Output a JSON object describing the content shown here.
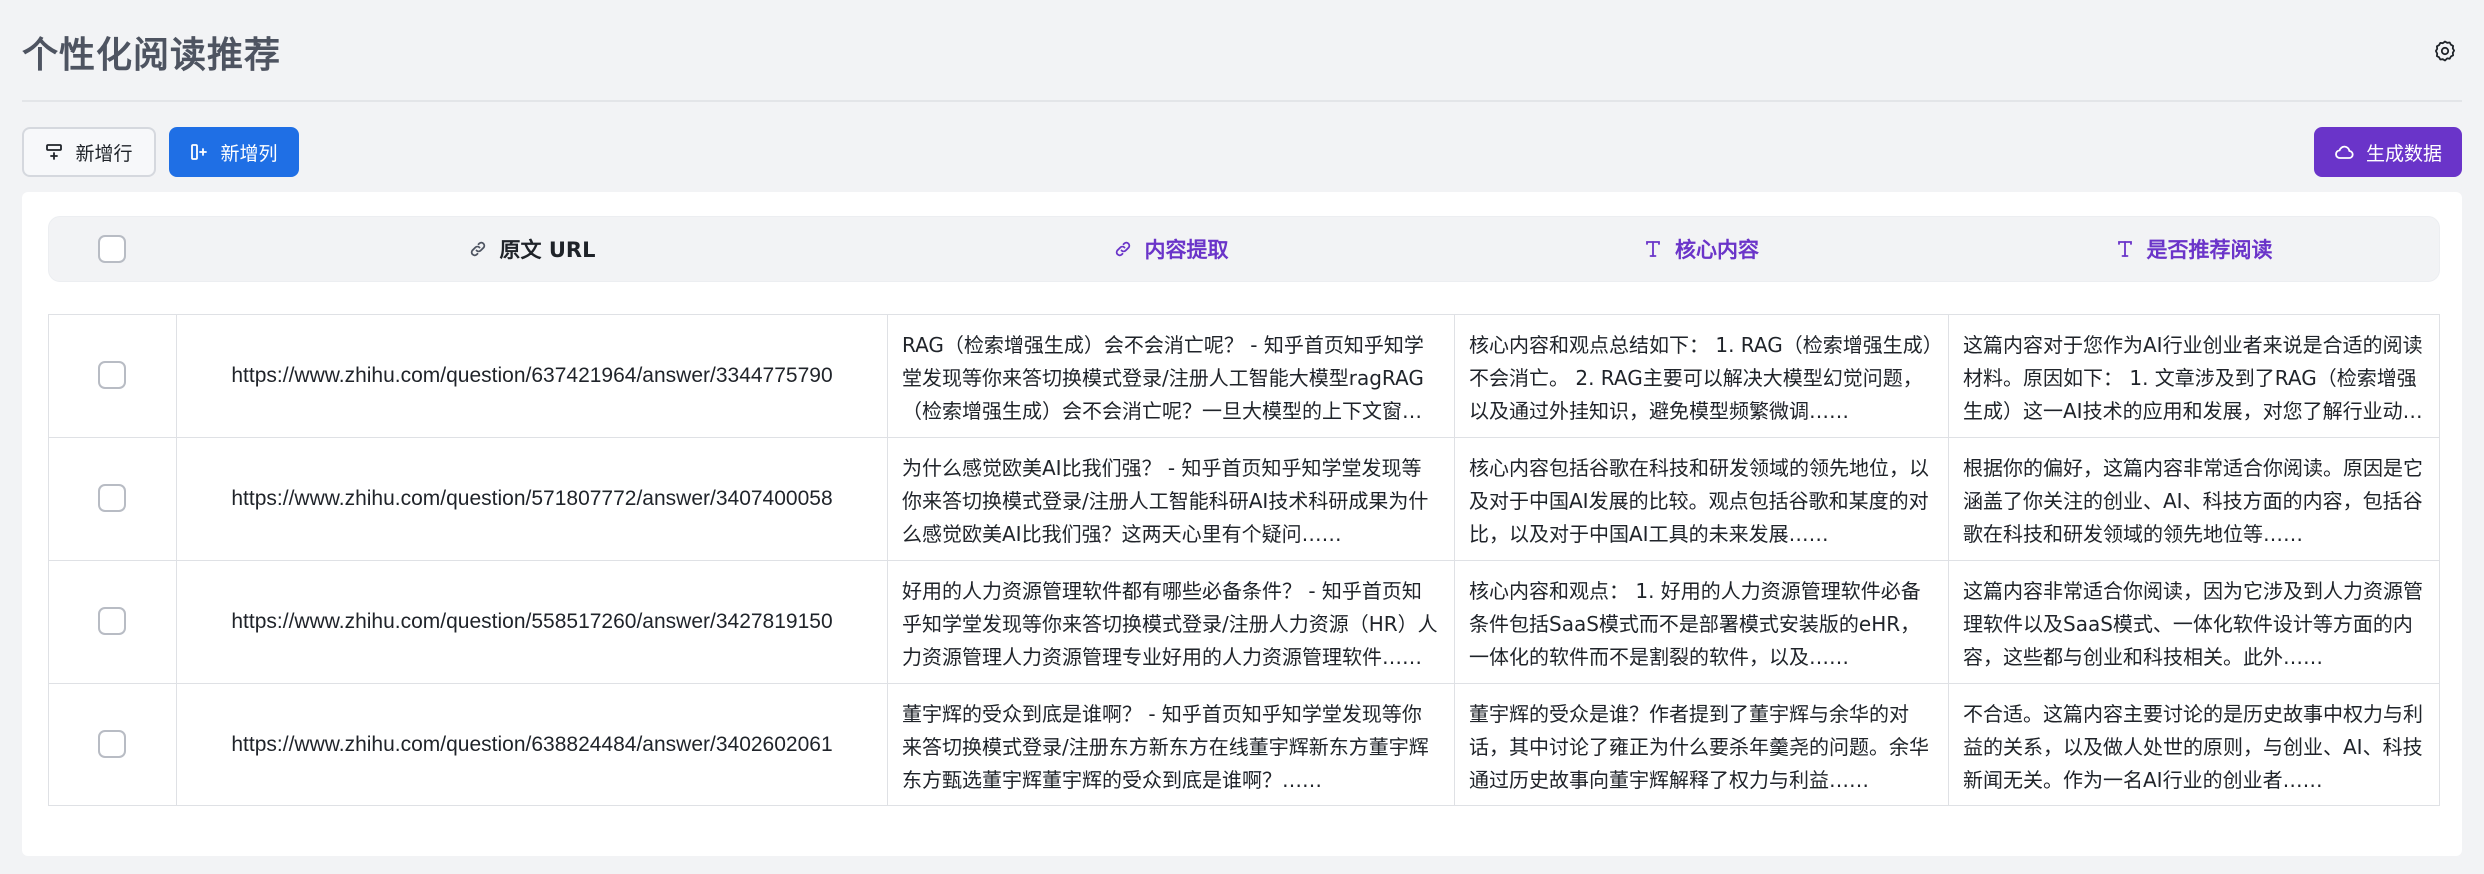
{
  "page": {
    "title": "个性化阅读推荐"
  },
  "toolbar": {
    "add_row_label": "新增行",
    "add_col_label": "新增列",
    "generate_label": "生成数据"
  },
  "table": {
    "columns": [
      {
        "label": "原文 URL",
        "icon": "link-icon"
      },
      {
        "label": "内容提取",
        "icon": "link-icon"
      },
      {
        "label": "核心内容",
        "icon": "text-type-icon"
      },
      {
        "label": "是否推荐阅读",
        "icon": "text-type-icon"
      }
    ],
    "rows": [
      {
        "url": "https://www.zhihu.com/question/637421964/answer/3344775790",
        "extract": "RAG（检索增强生成）会不会消亡呢？ - 知乎首页知乎知学堂发现等你来答切换模式登录/注册人工智能大模型ragRAG（检索增强生成）会不会消亡呢？一旦大模型的上下文窗口足够长……",
        "core": "核心内容和观点总结如下： 1. RAG（检索增强生成）不会消亡。 2. RAG主要可以解决大模型幻觉问题，以及通过外挂知识，避免模型频繁微调……",
        "recommend": "这篇内容对于您作为AI行业创业者来说是合适的阅读材料。原因如下： 1. 文章涉及到了RAG（检索增强生成）这一AI技术的应用和发展，对您了解行业动态有帮助……"
      },
      {
        "url": "https://www.zhihu.com/question/571807772/answer/3407400058",
        "extract": "为什么感觉欧美AI比我们强？ - 知乎首页知乎知学堂发现等你来答切换模式登录/注册人工智能科研AI技术科研成果为什么感觉欧美AI比我们强？这两天心里有个疑问……",
        "core": "核心内容包括谷歌在科技和研发领域的领先地位，以及对于中国AI发展的比较。观点包括谷歌和某度的对比，以及对于中国AI工具的未来发展……",
        "recommend": "根据你的偏好，这篇内容非常适合你阅读。原因是它涵盖了你关注的创业、AI、科技方面的内容，包括谷歌在科技和研发领域的领先地位等……"
      },
      {
        "url": "https://www.zhihu.com/question/558517260/answer/3427819150",
        "extract": "好用的人力资源管理软件都有哪些必备条件？ - 知乎首页知乎知学堂发现等你来答切换模式登录/注册人力资源（HR）人力资源管理人力资源管理专业好用的人力资源管理软件……",
        "core": "核心内容和观点： 1. 好用的人力资源管理软件必备条件包括SaaS模式而不是部署模式安装版的eHR，一体化的软件而不是割裂的软件，以及……",
        "recommend": "这篇内容非常适合你阅读，因为它涉及到人力资源管理软件以及SaaS模式、一体化软件设计等方面的内容，这些都与创业和科技相关。此外……"
      },
      {
        "url": "https://www.zhihu.com/question/638824484/answer/3402602061",
        "extract": "董宇辉的受众到底是谁啊？ - 知乎首页知乎知学堂发现等你来答切换模式登录/注册东方新东方在线董宇辉新东方董宇辉东方甄选董宇辉董宇辉的受众到底是谁啊？……",
        "core": "董宇辉的受众是谁？作者提到了董宇辉与余华的对话，其中讨论了雍正为什么要杀年羹尧的问题。余华通过历史故事向董宇辉解释了权力与利益……",
        "recommend": "不合适。这篇内容主要讨论的是历史故事中权力与利益的关系，以及做人处世的原则，与创业、AI、科技新闻无关。作为一名AI行业的创业者……"
      }
    ]
  },
  "colors": {
    "primary_blue": "#1f6fe5",
    "accent_purple": "#6a34c9",
    "title_gray": "#4e5461"
  }
}
